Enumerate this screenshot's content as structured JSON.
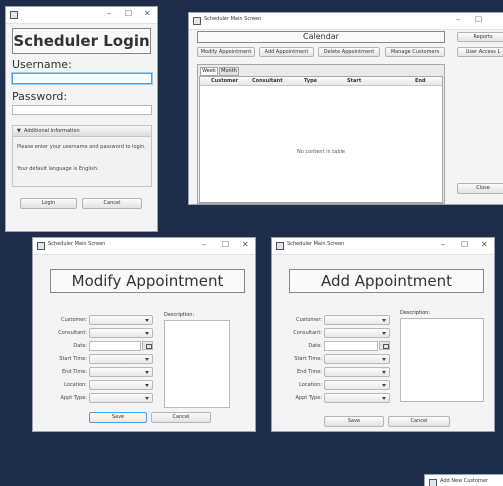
{
  "window_controls": {
    "minimize": "–",
    "maximize": "☐",
    "close": "✕"
  },
  "login": {
    "title": "Scheduler Login",
    "username_label": "Username:",
    "username_value": "",
    "password_label": "Password:",
    "password_value": "",
    "info_header": "Additional Information",
    "info_line1": "Please enter your username and password to login.",
    "info_line2": "Your default language is English.",
    "login_button": "Login",
    "cancel_button": "Cancel"
  },
  "main": {
    "window_title": "Scheduler Main Screen",
    "header": "Calendar",
    "toolbar": [
      "Modify Appointment",
      "Add Appointment",
      "Delete Appointment",
      "Manage Customers"
    ],
    "reports_button": "Reports",
    "user_access_button": "User Access L",
    "tabs": [
      "Week",
      "Month"
    ],
    "columns": [
      "Customer",
      "Consultant",
      "Type",
      "Start",
      "End"
    ],
    "empty_text": "No content in table",
    "close_button": "Close"
  },
  "modify": {
    "window_title": "Scheduler Main Screen",
    "title": "Modify Appointment",
    "labels": [
      "Customer:",
      "Consultant:",
      "Date:",
      "Start Time:",
      "End Time:",
      "Location:",
      "Appt Type:"
    ],
    "description_label": "Description:",
    "save_button": "Save",
    "cancel_button": "Cancel"
  },
  "add": {
    "window_title": "Scheduler Main Screen",
    "title": "Add Appointment",
    "labels": [
      "Customer:",
      "Consultant:",
      "Date:",
      "Start Time:",
      "End Time:",
      "Location:",
      "Appt Type:"
    ],
    "description_label": "Description:",
    "save_button": "Save",
    "cancel_button": "Cancel"
  },
  "customer": {
    "window_title": "Add New Customer"
  }
}
